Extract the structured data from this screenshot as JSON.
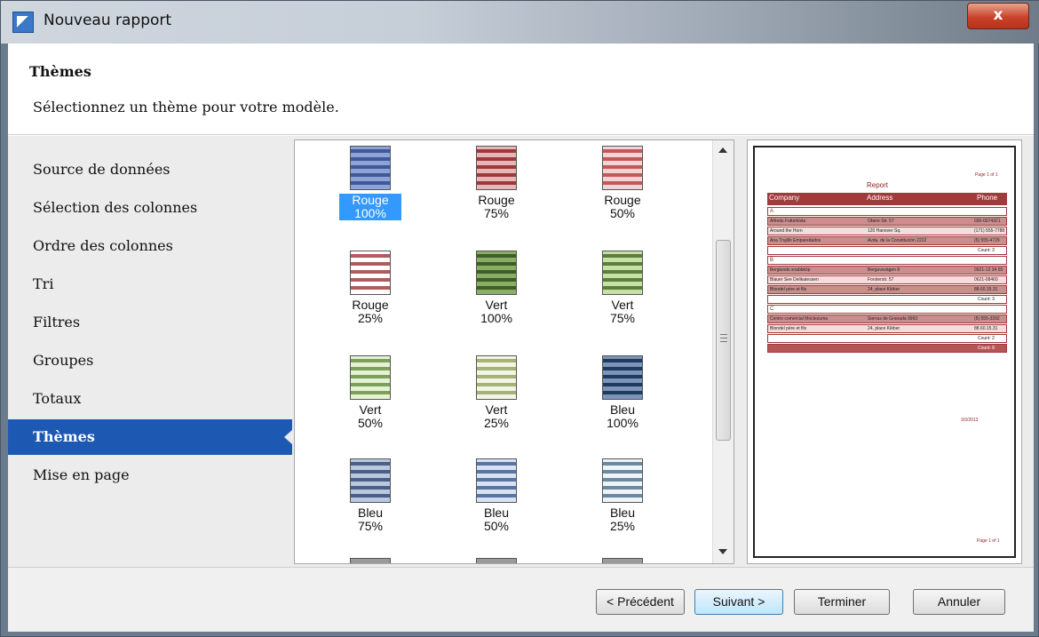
{
  "window": {
    "title": "Nouveau rapport",
    "close_label": "x"
  },
  "header": {
    "title": "Thèmes",
    "subtitle": "Sélectionnez un thème pour votre modèle."
  },
  "sidebar": {
    "items": [
      {
        "label": "Source de données",
        "active": false
      },
      {
        "label": "Sélection des colonnes",
        "active": false
      },
      {
        "label": "Ordre des colonnes",
        "active": false
      },
      {
        "label": "Tri",
        "active": false
      },
      {
        "label": "Filtres",
        "active": false
      },
      {
        "label": "Groupes",
        "active": false
      },
      {
        "label": "Totaux",
        "active": false
      },
      {
        "label": "Thèmes",
        "active": true
      },
      {
        "label": "Mise en page",
        "active": false
      }
    ]
  },
  "themes": [
    {
      "name": "Rouge",
      "pct": "100%",
      "colors": [
        "#3e5a9a",
        "#8ea3d6"
      ],
      "selected": true
    },
    {
      "name": "Rouge",
      "pct": "75%",
      "colors": [
        "#9c3a3a",
        "#e7b6b6"
      ],
      "selected": false
    },
    {
      "name": "Rouge",
      "pct": "50%",
      "colors": [
        "#c05a5a",
        "#f3d3d3"
      ],
      "selected": false
    },
    {
      "name": "Rouge",
      "pct": "25%",
      "colors": [
        "#b55a5a",
        "#ffffff"
      ],
      "selected": false
    },
    {
      "name": "Vert",
      "pct": "100%",
      "colors": [
        "#3f5e2a",
        "#8aae67"
      ],
      "selected": false
    },
    {
      "name": "Vert",
      "pct": "75%",
      "colors": [
        "#5c7f3c",
        "#c7e0a9"
      ],
      "selected": false
    },
    {
      "name": "Vert",
      "pct": "50%",
      "colors": [
        "#7da05c",
        "#e6f2d6"
      ],
      "selected": false
    },
    {
      "name": "Vert",
      "pct": "25%",
      "colors": [
        "#a4b27a",
        "#f4f6e3"
      ],
      "selected": false
    },
    {
      "name": "Bleu",
      "pct": "100%",
      "colors": [
        "#1f3a5f",
        "#7c95b8"
      ],
      "selected": false
    },
    {
      "name": "Bleu",
      "pct": "75%",
      "colors": [
        "#4a5f86",
        "#b9c8de"
      ],
      "selected": false
    },
    {
      "name": "Bleu",
      "pct": "50%",
      "colors": [
        "#5a74a6",
        "#d8e3f2"
      ],
      "selected": false
    },
    {
      "name": "Bleu",
      "pct": "25%",
      "colors": [
        "#6a8aa0",
        "#eef4f7"
      ],
      "selected": false
    }
  ],
  "preview": {
    "page_top": "Page 1 of 1",
    "title": "Report",
    "columns": [
      "Company",
      "Address",
      "Phone"
    ],
    "groups": [
      {
        "key": "A",
        "rows": [
          [
            "Alfreds Futterkiste",
            "Obere Str. 57",
            "030-0074321"
          ],
          [
            "Around the Horn",
            "120 Hanover Sq.",
            "(171) 555-7788"
          ],
          [
            "Ana Trujillo Emparedados",
            "Avda. de la Constitución 2222",
            "(5) 555-4729"
          ]
        ],
        "count": "Count: 3"
      },
      {
        "key": "B",
        "rows": [
          [
            "Berglunds snabbköp",
            "Berguvsvägen 8",
            "0921-12 34 65"
          ],
          [
            "Blauer See Delikatessen",
            "Forsterstr. 57",
            "0621-08460"
          ],
          [
            "Blondel père et fils",
            "24, place Kléber",
            "88.60.15.31"
          ]
        ],
        "count": "Count: 3"
      },
      {
        "key": "C",
        "rows": [
          [
            "Centro comercial Moctezuma",
            "Sierras de Granada 9993",
            "(5) 555-3392"
          ],
          [
            "Blondel père et fils",
            "24, place Kléber",
            "88.60.15.31"
          ]
        ],
        "count": "Count: 2"
      }
    ],
    "grand_total": "Count: 8",
    "date": "3/3/2013",
    "page_bottom": "Page 1 of 1"
  },
  "footer": {
    "prev_label": "< Précédent",
    "next_label": "Suivant >",
    "finish_label": "Terminer",
    "cancel_label": "Annuler"
  }
}
